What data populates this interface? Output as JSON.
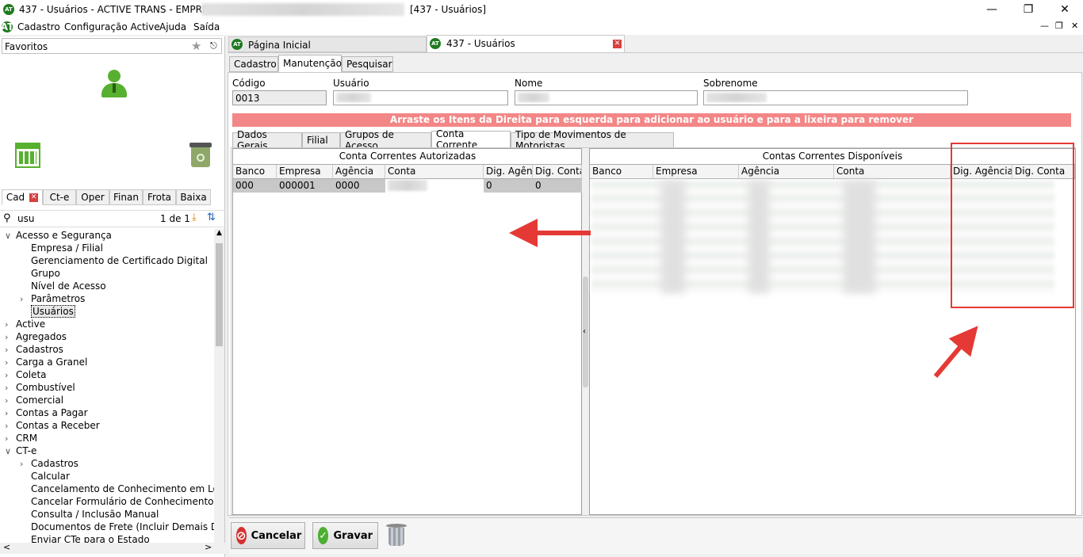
{
  "window": {
    "title_prefix": "437 - Usuários - ACTIVE TRANS - EMPRESA:",
    "title_suffix": "[437 - Usuários]",
    "logo_text": "AT"
  },
  "menu": [
    "Cadastro",
    "Configuração Active",
    "Ajuda",
    "Saída"
  ],
  "sidebar": {
    "favorites_label": "Favoritos",
    "tabs": [
      "Cad",
      "Ct-e",
      "Oper",
      "Finan",
      "Frota",
      "Baixa"
    ],
    "search_value": "usu",
    "search_count": "1 de 1",
    "tree": [
      {
        "label": "Acesso e Segurança",
        "level": 0,
        "expander": "v"
      },
      {
        "label": "Empresa / Filial",
        "level": 1,
        "expander": ""
      },
      {
        "label": "Gerenciamento de Certificado Digital",
        "level": 1,
        "expander": ""
      },
      {
        "label": "Grupo",
        "level": 1,
        "expander": ""
      },
      {
        "label": "Nível de Acesso",
        "level": 1,
        "expander": ""
      },
      {
        "label": "Parâmetros",
        "level": 1,
        "expander": ">"
      },
      {
        "label": "Usuários",
        "level": 1,
        "expander": "",
        "selected": true
      },
      {
        "label": "Active",
        "level": 0,
        "expander": ">"
      },
      {
        "label": "Agregados",
        "level": 0,
        "expander": ">"
      },
      {
        "label": "Cadastros",
        "level": 0,
        "expander": ">"
      },
      {
        "label": "Carga a Granel",
        "level": 0,
        "expander": ">"
      },
      {
        "label": "Coleta",
        "level": 0,
        "expander": ">"
      },
      {
        "label": "Combustível",
        "level": 0,
        "expander": ">"
      },
      {
        "label": "Comercial",
        "level": 0,
        "expander": ">"
      },
      {
        "label": "Contas a Pagar",
        "level": 0,
        "expander": ">"
      },
      {
        "label": "Contas a Receber",
        "level": 0,
        "expander": ">"
      },
      {
        "label": "CRM",
        "level": 0,
        "expander": ">"
      },
      {
        "label": "CT-e",
        "level": 0,
        "expander": "v"
      },
      {
        "label": "Cadastros",
        "level": 1,
        "expander": ">"
      },
      {
        "label": "Calcular",
        "level": 1,
        "expander": ""
      },
      {
        "label": "Cancelamento de Conhecimento em Lo",
        "level": 1,
        "expander": ""
      },
      {
        "label": "Cancelar Formulário de Conhecimento",
        "level": 1,
        "expander": ""
      },
      {
        "label": "Consulta / Inclusão Manual",
        "level": 1,
        "expander": ""
      },
      {
        "label": "Documentos de Frete (Incluir Demais D",
        "level": 1,
        "expander": ""
      },
      {
        "label": "Enviar CTe para o Estado",
        "level": 1,
        "expander": ""
      }
    ]
  },
  "doc_tabs": [
    {
      "label": "Página Inicial"
    },
    {
      "label": "437 - Usuários"
    }
  ],
  "mode_tabs": [
    "Cadastro",
    "Manutenção",
    "Pesquisar"
  ],
  "form": {
    "codigo_label": "Código",
    "codigo_value": "0013",
    "usuario_label": "Usuário",
    "nome_label": "Nome",
    "sobrenome_label": "Sobrenome"
  },
  "banner": "Arraste os Itens da Direita para esquerda para adicionar ao usuário e para a lixeira para remover",
  "sub_tabs": [
    "Dados Gerais",
    "Filial",
    "Grupos de Acesso",
    "Conta Corrente",
    "Tipo de Movimentos de Motoristas"
  ],
  "left_grid": {
    "title": "Conta Correntes Autorizadas",
    "headers": [
      "Banco",
      "Empresa",
      "Agência",
      "Conta",
      "Dig. Agên",
      "Dig. Conta"
    ],
    "rows": [
      [
        "000",
        "000001",
        "0000",
        "",
        "0",
        "0"
      ]
    ]
  },
  "right_grid": {
    "title": "Contas Correntes Disponíveis",
    "headers": [
      "Banco",
      "Empresa",
      "Agência",
      "Conta",
      "Dig. Agência",
      "Dig. Conta"
    ]
  },
  "buttons": {
    "cancel": "Cancelar",
    "save": "Gravar"
  },
  "colors": {
    "banner": "#f38686",
    "annotation": "#e53935",
    "selection": "#c8c8c8"
  }
}
